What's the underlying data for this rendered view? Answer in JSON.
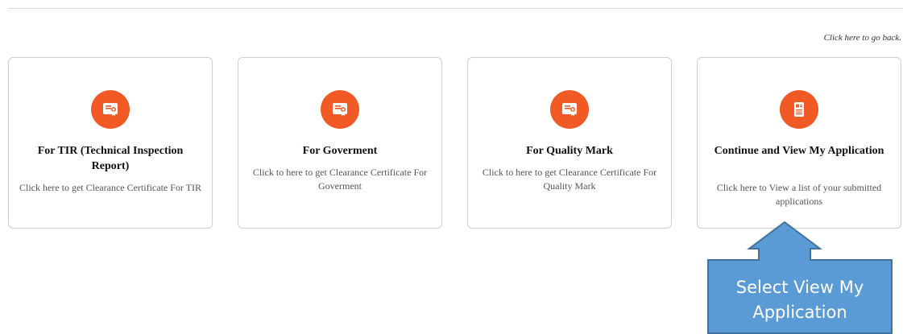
{
  "back_link": "Click here to go back.",
  "cards": [
    {
      "icon": "certificate-icon",
      "title": "For TIR (Technical Inspection Report)",
      "description": "Click here to get Clearance Certificate For TIR"
    },
    {
      "icon": "certificate-icon",
      "title": "For Goverment",
      "description": "Click to here to get Clearance Certificate For Goverment"
    },
    {
      "icon": "certificate-icon",
      "title": "For Quality Mark",
      "description": "Click to here to get Clearance Certificate For Quality Mark"
    },
    {
      "icon": "application-document-icon",
      "title": "Continue and View My Application",
      "description": "Click here to View a list of your submitted applications"
    }
  ],
  "callout": {
    "text_line1": "Select View My",
    "text_line2": "Application",
    "fill_color": "#5b9bd5",
    "stroke_color": "#41719c"
  },
  "colors": {
    "icon_circle": "#f15a24"
  }
}
